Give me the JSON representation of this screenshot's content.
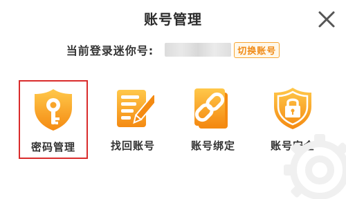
{
  "dialog": {
    "title": "账号管理",
    "close_icon": "close-icon"
  },
  "account": {
    "label": "当前登录迷你号:",
    "masked_value_icon": "blurred-number",
    "switch_label": "切换账号"
  },
  "actions": [
    {
      "label": "密码管理",
      "icon": "key-shield-icon",
      "selected": true
    },
    {
      "label": "找回账号",
      "icon": "document-pencil-icon",
      "selected": false
    },
    {
      "label": "账号绑定",
      "icon": "chain-link-icon",
      "selected": false
    },
    {
      "label": "账号安全",
      "icon": "lock-shield-icon",
      "selected": false
    }
  ],
  "colors": {
    "accent_orange": "#f7a531",
    "accent_orange_dark": "#f08a16",
    "selection_border": "#d92b2b",
    "text": "#333333"
  }
}
